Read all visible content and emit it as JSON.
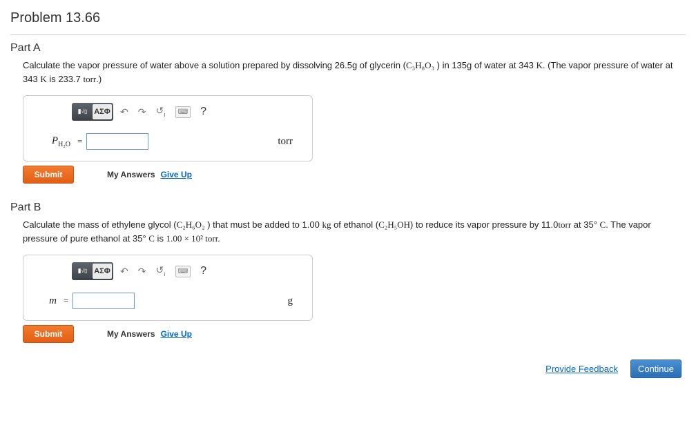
{
  "problem": {
    "title": "Problem 13.66"
  },
  "partA": {
    "title": "Part A",
    "text_pre": "Calculate the vapor pressure of water above a solution prepared by dissolving 26.5g of glycerin (",
    "formula": "C₃H₈O₃",
    "text_mid": " ) in 135g of water at 343 ",
    "unitK": "K",
    "text_post1": ". (The vapor pressure of water at 343 ",
    "text_post2": " is 233.7 ",
    "torr": "torr",
    "text_end": ".)",
    "var_label": "P",
    "var_sub": "H₂O",
    "equals": "=",
    "unit": "torr",
    "submit": "Submit",
    "my_answers": "My Answers",
    "give_up": "Give Up"
  },
  "partB": {
    "title": "Part B",
    "text_pre": "Calculate the mass of ethylene glycol (",
    "formula1": "C₂H₆O₂",
    "text_mid1": " ) that must be added to 1.00 ",
    "kg": "kg",
    "text_mid2": " of ethanol (",
    "formula2": "C₂H₅OH",
    "text_mid3": ") to reduce its vapor pressure by 11.0",
    "torr": "torr",
    "text_mid4": " at 35° ",
    "unitC": "C",
    "text_mid5": ". The vapor pressure of pure ethanol at 35° ",
    "text_mid6": " is ",
    "sci": "1.00 × 10²",
    "text_end": " torr.",
    "var_label": "m",
    "equals": "=",
    "unit": "g",
    "submit": "Submit",
    "my_answers": "My Answers",
    "give_up": "Give Up"
  },
  "toolbar": {
    "templates_icon": "⎕√̅⎕",
    "greek": "ΑΣΦ",
    "undo": "↶",
    "redo": "↷",
    "reset": "↺",
    "keyboard": "⌨",
    "help": "?"
  },
  "footer": {
    "feedback": "Provide Feedback",
    "continue": "Continue"
  }
}
